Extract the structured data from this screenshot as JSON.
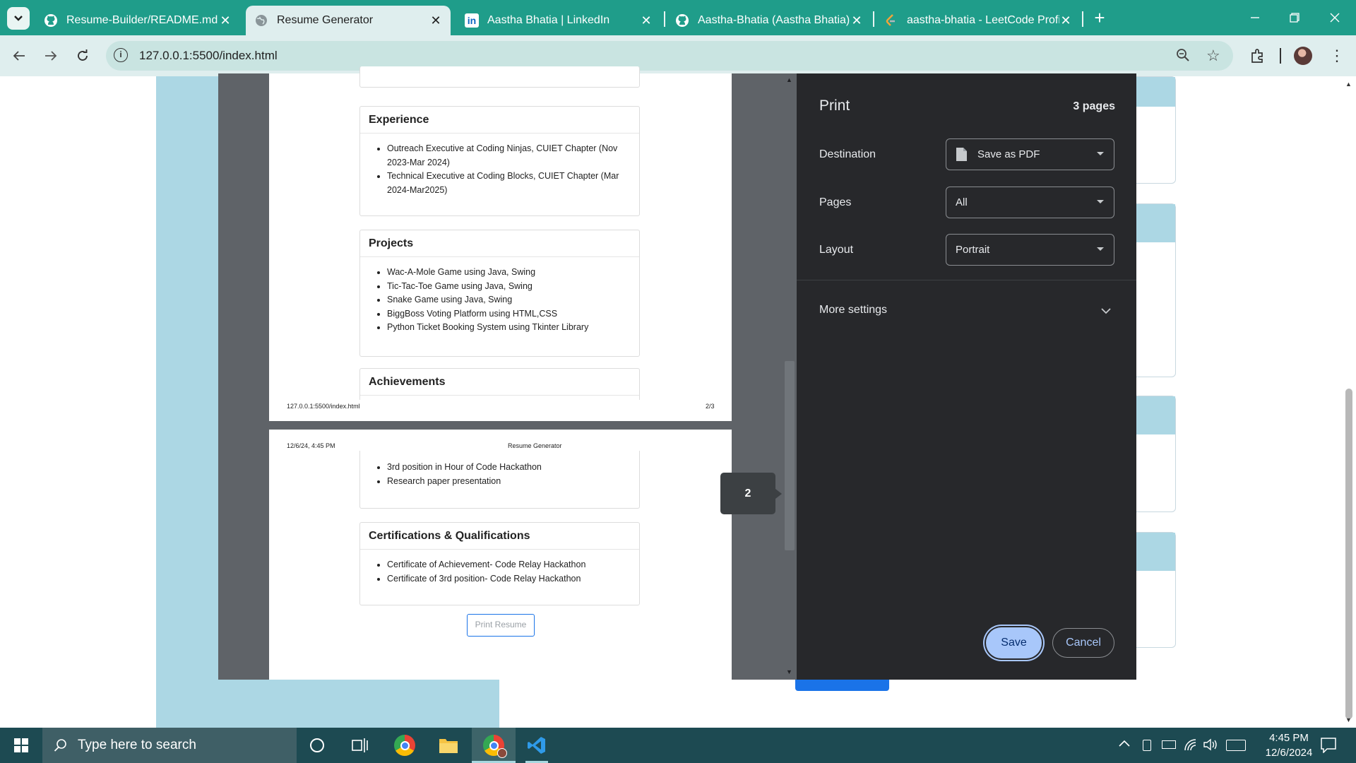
{
  "browser": {
    "tabs": [
      {
        "title": "Resume-Builder/README.md at",
        "icon": "github-icon"
      },
      {
        "title": "Resume Generator",
        "icon": "globe-icon"
      },
      {
        "title": "Aastha Bhatia | LinkedIn",
        "icon": "linkedin-icon"
      },
      {
        "title": "Aastha-Bhatia (Aastha Bhatia)",
        "icon": "github-icon"
      },
      {
        "title": "aastha-bhatia - LeetCode Profile",
        "icon": "leetcode-icon"
      }
    ],
    "url": "127.0.0.1:5500/index.html"
  },
  "preview": {
    "page2": {
      "experience": {
        "heading": "Experience",
        "items": [
          "Outreach Executive at Coding Ninjas, CUIET Chapter (Nov 2023-Mar 2024)",
          "Technical Executive at Coding Blocks, CUIET Chapter (Mar 2024-Mar2025)"
        ]
      },
      "projects": {
        "heading": "Projects",
        "items": [
          "Wac-A-Mole Game using Java, Swing",
          "Tic-Tac-Toe Game using Java, Swing",
          "Snake Game using Java, Swing",
          "BiggBoss Voting Platform using HTML,CSS",
          "Python Ticket Booking System using Tkinter Library"
        ]
      },
      "achievements_heading": "Achievements",
      "footer_url": "127.0.0.1:5500/index.html",
      "footer_page": "2/3"
    },
    "page3": {
      "header_date": "12/6/24, 4:45 PM",
      "header_title": "Resume Generator",
      "achievements_items": [
        "3rd position in Hour of Code Hackathon",
        "Research paper presentation"
      ],
      "certifications": {
        "heading": "Certifications & Qualifications",
        "items": [
          "Certificate of Achievement- Code Relay Hackathon",
          "Certificate of 3rd position- Code Relay Hackathon"
        ]
      },
      "print_button": "Print Resume"
    },
    "page_badge": "2"
  },
  "print": {
    "title": "Print",
    "page_count": "3 pages",
    "destination_label": "Destination",
    "destination_value": "Save as PDF",
    "pages_label": "Pages",
    "pages_value": "All",
    "layout_label": "Layout",
    "layout_value": "Portrait",
    "more_settings": "More settings",
    "save": "Save",
    "cancel": "Cancel"
  },
  "taskbar": {
    "search_placeholder": "Type here to search",
    "time": "4:45 PM",
    "date": "12/6/2024"
  },
  "colors": {
    "tabbar": "#1f9d8a",
    "toolbar": "#dfeeee",
    "print_panel": "#27282b",
    "save_button": "#a8c7fa",
    "taskbar": "#1d4a52"
  }
}
